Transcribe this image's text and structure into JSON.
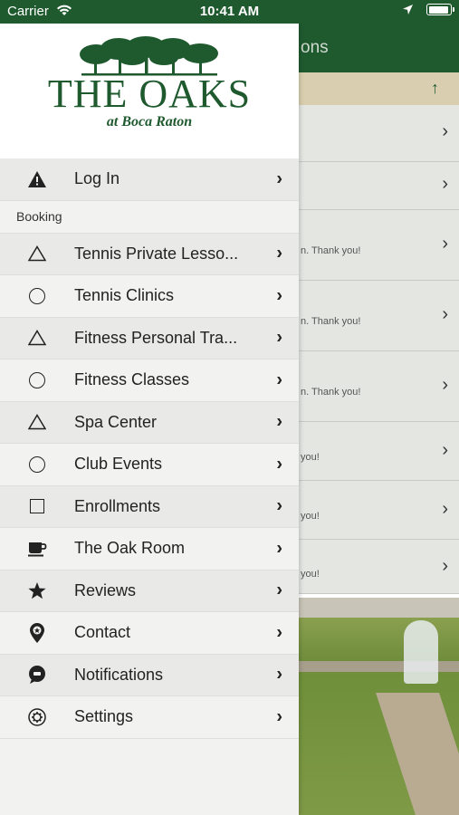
{
  "status_bar": {
    "carrier": "Carrier",
    "time": "10:41 AM"
  },
  "background": {
    "header_title": "ons",
    "rows": [
      {
        "text": ""
      },
      {
        "text": ""
      },
      {
        "text": "n. Thank you!"
      },
      {
        "text": "n.  Thank you!"
      },
      {
        "text": "n. Thank you!"
      },
      {
        "text": "you!"
      },
      {
        "text": "you!"
      },
      {
        "text": "you!"
      }
    ]
  },
  "logo": {
    "title": "THE OAKS",
    "subtitle": "at Boca Raton"
  },
  "menu": {
    "login": {
      "label": "Log In",
      "icon": "warning-icon"
    },
    "section_label": "Booking",
    "items": [
      {
        "label": "Tennis Private Lesso...",
        "icon": "triangle-outline-icon"
      },
      {
        "label": "Tennis Clinics",
        "icon": "circle-outline-icon"
      },
      {
        "label": "Fitness Personal Tra...",
        "icon": "triangle-outline-icon"
      },
      {
        "label": "Fitness Classes",
        "icon": "circle-outline-icon"
      },
      {
        "label": "Spa Center",
        "icon": "triangle-outline-icon"
      },
      {
        "label": "Club Events",
        "icon": "circle-outline-icon"
      },
      {
        "label": "Enrollments",
        "icon": "square-outline-icon"
      },
      {
        "label": "The Oak Room",
        "icon": "coffee-cup-icon"
      },
      {
        "label": "Reviews",
        "icon": "star-icon"
      },
      {
        "label": "Contact",
        "icon": "location-pin-icon"
      },
      {
        "label": "Notifications",
        "icon": "chat-bubble-icon"
      },
      {
        "label": "Settings",
        "icon": "gear-icon"
      }
    ]
  },
  "colors": {
    "brand_green": "#1f5a2f",
    "tan_bar": "#d9cfb0"
  }
}
